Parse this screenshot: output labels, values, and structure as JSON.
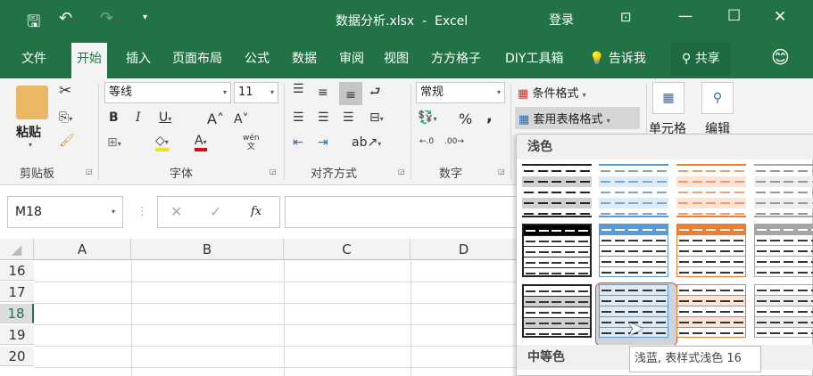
{
  "title": "数据分析.xlsx  -  Excel",
  "login": "登录",
  "tabs": [
    "文件",
    "开始",
    "插入",
    "页面布局",
    "公式",
    "数据",
    "审阅",
    "视图",
    "方方格子",
    "DIY工具箱"
  ],
  "tell_me": "告诉我",
  "share": "共享",
  "ribbon": {
    "paste": "粘贴",
    "font_name": "等线",
    "font_size": "11",
    "number_format": "常规",
    "percent": "%",
    "comma": ",",
    "conditional_format": "条件格式",
    "format_as_table": "套用表格格式",
    "cells": "单元格",
    "editing": "编辑",
    "phonetic": "wén",
    "groups": [
      "剪贴板",
      "字体",
      "对齐方式",
      "数字"
    ]
  },
  "formula_bar": {
    "name_box": "M18",
    "fx": "fx",
    "value": ""
  },
  "columns": [
    "A",
    "B",
    "C",
    "D"
  ],
  "rows": [
    "16",
    "17",
    "18",
    "19",
    "20"
  ],
  "selected_row": "18",
  "gallery": {
    "section_light": "浅色",
    "section_medium": "中等色",
    "tooltip": "浅蓝, 表样式浅色 16"
  },
  "colors": {
    "brand": "#217346",
    "blue": "#5b9bd5",
    "orange": "#ed7d31",
    "gray": "#a5a5a5"
  }
}
